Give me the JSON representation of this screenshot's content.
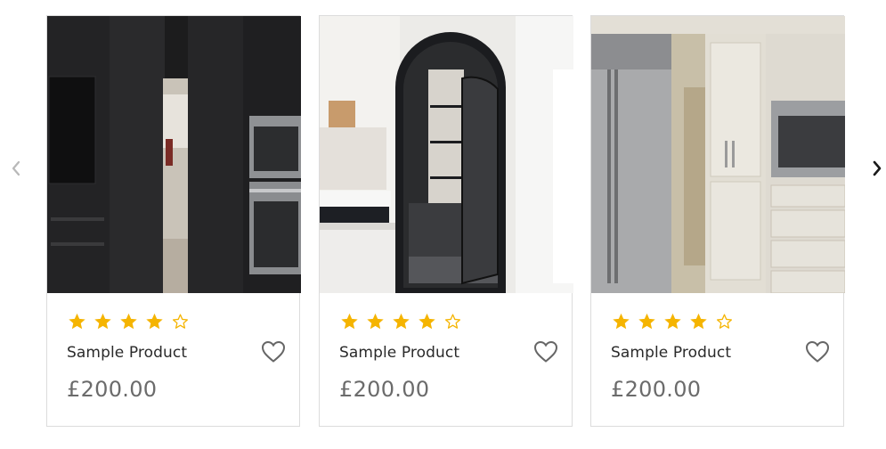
{
  "carousel": {
    "prev_icon": "chevron-left-icon",
    "next_icon": "chevron-right-icon",
    "products": [
      {
        "rating": 4,
        "max_rating": 5,
        "name": "Sample Product",
        "price": "£200.00",
        "image": "dark-kitchen-cabinets-photo",
        "wishlist_icon": "heart-outline-icon"
      },
      {
        "rating": 4,
        "max_rating": 5,
        "name": "Sample Product",
        "price": "£200.00",
        "image": "arched-pantry-door-photo",
        "wishlist_icon": "heart-outline-icon"
      },
      {
        "rating": 4,
        "max_rating": 5,
        "name": "Sample Product",
        "price": "£200.00",
        "image": "panelled-fridge-pantry-photo",
        "wishlist_icon": "heart-outline-icon"
      }
    ]
  },
  "colors": {
    "star_filled": "#f5b400",
    "star_empty": "#f5b400",
    "border": "#dcdcdc",
    "price": "#6b6b6b",
    "title": "#2a2a2a",
    "icon": "#666666"
  }
}
